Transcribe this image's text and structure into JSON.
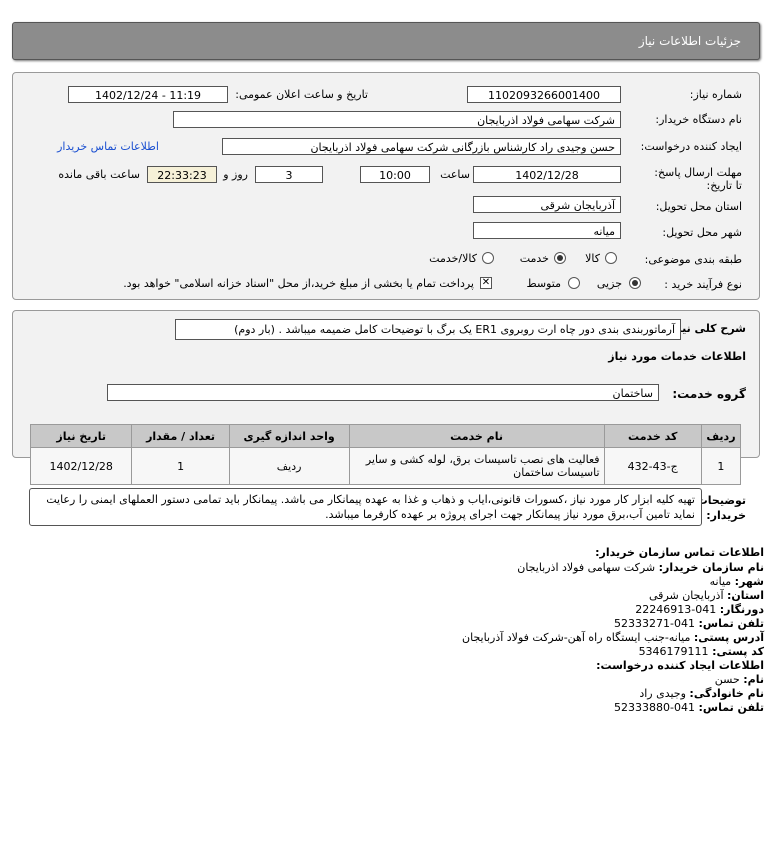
{
  "header": {
    "title": "جزئیات اطلاعات نیاز"
  },
  "form": {
    "need_number_label": "شماره نیاز:",
    "need_number": "1102093266001400",
    "announce_label": "تاریخ و ساعت اعلان عمومی:",
    "announce_value": "1402/12/24 - 11:19",
    "buyer_org_label": "نام دستگاه خریدار:",
    "buyer_org": "شرکت سهامی فولاد اذربایجان",
    "creator_label": "ایجاد کننده درخواست:",
    "creator": "حسن وجیدی راد کارشناس بازرگانی شرکت سهامی فولاد اذربایجان",
    "contact_link": "اطلاعات تماس خریدار",
    "deadline_label": "مهلت ارسال پاسخ: تا تاریخ:",
    "deadline_date": "1402/12/28",
    "time_label": "ساعت",
    "deadline_time": "10:00",
    "days_value": "3",
    "days_label": "روز و",
    "remaining_value": "22:33:23",
    "remaining_label": "ساعت باقی مانده",
    "province_label": "استان محل تحویل:",
    "province": "آذربایجان شرقی",
    "city_label": "شهر محل تحویل:",
    "city": "میانه",
    "category_label": "طبقه بندی موضوعی:",
    "category_options": [
      "کالا",
      "خدمت",
      "کالا/خدمت"
    ],
    "category_selected": "خدمت",
    "process_label": "نوع فرآیند خرید :",
    "process_options": [
      "جزیی",
      "متوسط"
    ],
    "process_selected": "جزیی",
    "treasury_note": "پرداخت تمام یا بخشی از مبلغ خرید،از محل \"اسناد خزانه اسلامی\" خواهد بود."
  },
  "description": {
    "label": "شرح کلی نیاز:",
    "text": "آرماتوربندی بندی دور چاه ارت روبروی ER1 یک برگ با توضیحات کامل ضمیمه میباشد . (بار دوم)"
  },
  "services": {
    "section_title": "اطلاعات خدمات مورد نیاز",
    "group_label": "گروه خدمت:",
    "group_value": "ساختمان",
    "columns": [
      "ردیف",
      "کد خدمت",
      "نام خدمت",
      "واحد اندازه گیری",
      "تعداد / مقدار",
      "تاریخ نیاز"
    ],
    "rows": [
      [
        "1",
        "ج-43-432",
        "فعالیت های نصب تاسیسات برق، لوله کشی و سایر تاسیسات ساختمان",
        "ردیف",
        "1",
        "1402/12/28"
      ]
    ]
  },
  "buyer_notes": {
    "label": "توضیحات خریدار:",
    "text": "تهیه کلیه ابزار کار مورد نیاز ،کسورات قانونی،ایاب و ذهاب و غذا به عهده پیمانکار می باشد. پیمانکار باید تمامی دستور العملهای ایمنی را رعایت نماید تامین آب،برق مورد نیاز پیمانکار جهت اجرای پروژه بر عهده کارفرما میباشد."
  },
  "contact": {
    "org_title": "اطلاعات تماس سازمان خریدار:",
    "buyer_name_label": "نام سازمان خریدار:",
    "buyer_name": "شرکت سهامی فولاد اذربایجان",
    "city_label": "شهر:",
    "city": "میانه",
    "province_label": "استان:",
    "province": "آذربایجان شرقی",
    "fax_label": "دورنگار:",
    "fax": "041-22246913",
    "phone_label": "تلفن تماس:",
    "phone": "041-52333271",
    "address_label": "آدرس پستی:",
    "address": "میانه-جنب ایستگاه راه آهن-شرکت فولاد آذربایجان",
    "postal_label": "کد پستی:",
    "postal": "5346179111",
    "creator_title": "اطلاعات ایجاد کننده درخواست:",
    "first_name_label": "نام:",
    "first_name": "حسن",
    "last_name_label": "نام خانوادگی:",
    "last_name": "وجیدی راد",
    "creator_phone_label": "تلفن تماس:",
    "creator_phone": "041-52333880"
  }
}
